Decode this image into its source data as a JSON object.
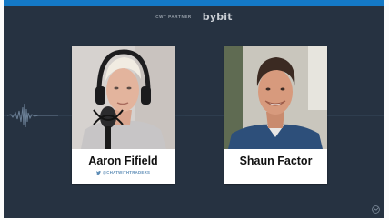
{
  "header": {
    "partner_label": "CWT PARTNER",
    "brand_logo": "bybit"
  },
  "guests": [
    {
      "name": "Aaron Fifield",
      "handle": "@CHATWITHTRADERS",
      "handle_icon": "twitter-bird-icon"
    },
    {
      "name": "Shaun Factor"
    }
  ],
  "icons": {
    "corner": "chart-trend-icon"
  },
  "colors": {
    "background": "#263241",
    "top_bar": "#1479c6",
    "card": "#ffffff",
    "handle": "#5b8bb5"
  }
}
